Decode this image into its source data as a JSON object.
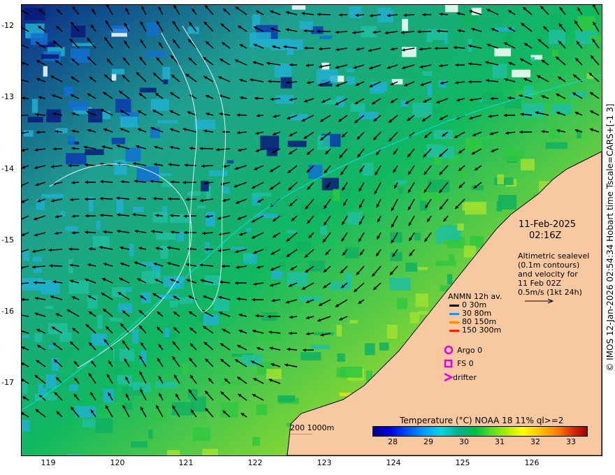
{
  "map": {
    "date": "11-Feb-2025",
    "time": "02:16Z",
    "description_lines": [
      "Altimetric sealevel",
      "(0.1m contours)",
      "and velocity for",
      "11 Feb 02Z",
      "0.5m/s (1kt 24h)"
    ],
    "y_ticks": [
      "-12",
      "-13",
      "-14",
      "-15",
      "-16",
      "-17"
    ],
    "x_ticks": [
      "119",
      "120",
      "121",
      "122",
      "123",
      "124",
      "125",
      "126"
    ],
    "copyright": "© IMOS 12-Jan-2026 02:54:34 Hobart time Tscale=CARS+[-1 3]",
    "bathy_label": "200  1000m",
    "colorbar": {
      "title": "Temperature (°C) NOAA 18 11% ql>=2",
      "ticks": [
        "28",
        "29",
        "30",
        "31",
        "32",
        "33"
      ]
    },
    "legend": {
      "title": "ANMN 12h av.",
      "items": [
        {
          "label": "0 30m",
          "color": "#000000"
        },
        {
          "label": "30 80m",
          "color": "#1e90ff"
        },
        {
          "label": "80 150m",
          "color": "#ff8c00"
        },
        {
          "label": "150 300m",
          "color": "#ff2000"
        }
      ],
      "argo": "Argo 0",
      "fs": "FS 0",
      "drifter": "drifter",
      "marker_color": "#e000e0"
    },
    "colors": {
      "land": "#f8c8a0",
      "coast": "#000000",
      "contour": "#e8f0ff",
      "bathy": "#00e0e0"
    }
  }
}
